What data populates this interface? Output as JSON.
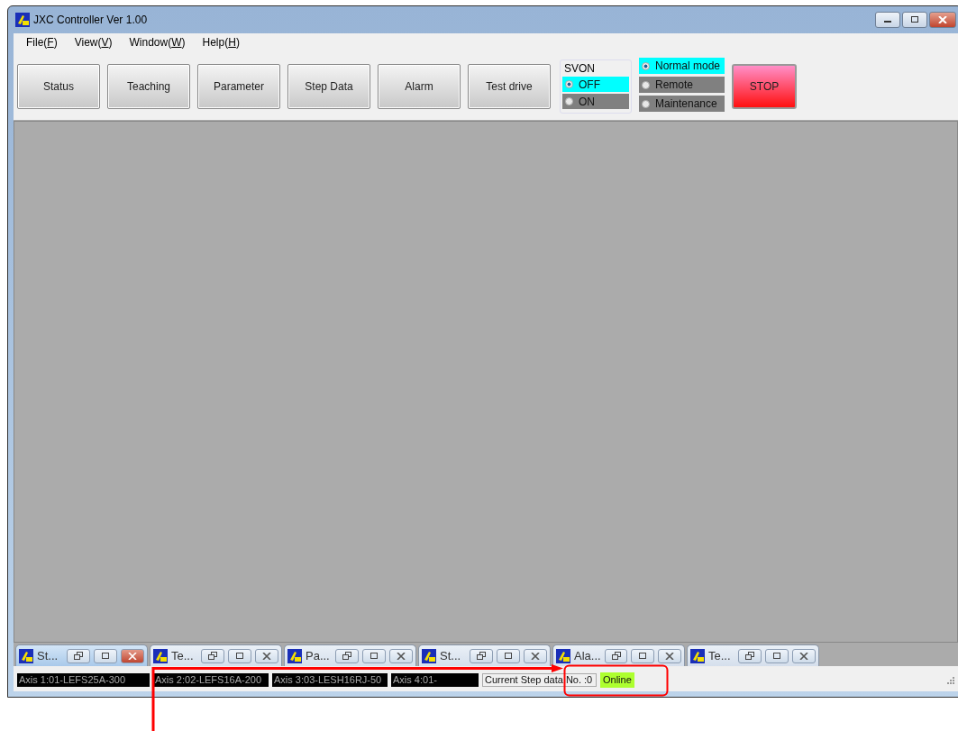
{
  "window": {
    "title": "JXC Controller Ver 1.00"
  },
  "menu": [
    {
      "label": "File(",
      "key": "F",
      "end": ")"
    },
    {
      "label": "View(",
      "key": "V",
      "end": ")"
    },
    {
      "label": "Window(",
      "key": "W",
      "end": ")"
    },
    {
      "label": "Help(",
      "key": "H",
      "end": ")"
    }
  ],
  "toolbar": {
    "buttons": [
      "Status",
      "Teaching",
      "Parameter",
      "Step Data",
      "Alarm",
      "Test drive"
    ],
    "svon": {
      "title": "SVON",
      "options": [
        {
          "label": "OFF",
          "selected": true
        },
        {
          "label": "ON",
          "selected": false
        }
      ]
    },
    "mode": [
      {
        "label": "Normal mode",
        "selected": true
      },
      {
        "label": "Remote",
        "selected": false
      },
      {
        "label": "Maintenance",
        "selected": false
      }
    ],
    "stop": "STOP"
  },
  "tabs": [
    {
      "label": "St...",
      "selected": true
    },
    {
      "label": "Te...",
      "selected": false
    },
    {
      "label": "Pa...",
      "selected": false
    },
    {
      "label": "St...",
      "selected": false
    },
    {
      "label": "Ala...",
      "selected": false
    },
    {
      "label": "Te...",
      "selected": false
    }
  ],
  "status_bar": {
    "axes": [
      "Axis 1:01-LEFS25A-300",
      "Axis 2:02-LEFS16A-200",
      "Axis 3:03-LESH16RJ-50",
      "Axis 4:01-"
    ],
    "step": "Current Step data No. :0",
    "connection": "Online"
  }
}
